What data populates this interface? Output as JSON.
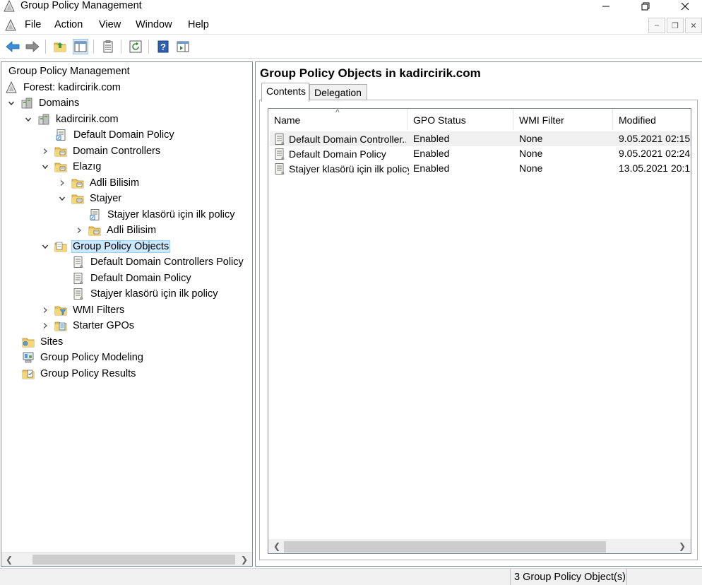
{
  "window": {
    "title": "Group Policy Management"
  },
  "menu": {
    "items": [
      "File",
      "Action",
      "View",
      "Window",
      "Help"
    ]
  },
  "tree": {
    "root": "Group Policy Management",
    "forest": "Forest: kadircirik.com",
    "domains": "Domains",
    "domain": "kadircirik.com",
    "default_domain_policy": "Default Domain Policy",
    "domain_controllers": "Domain Controllers",
    "elazig": "Elazıg",
    "adli_bilisim_1": "Adli Bilisim",
    "stajyer": "Stajyer",
    "stajyer_policy": "Stajyer klasörü için ilk policy",
    "adli_bilisim_2": "Adli Bilisim",
    "gpo": "Group Policy Objects",
    "gpo_ddcp": "Default Domain Controllers Policy",
    "gpo_ddp": "Default Domain Policy",
    "gpo_stajyer": "Stajyer klasörü için ilk policy",
    "wmi_filters": "WMI Filters",
    "starter_gpos": "Starter GPOs",
    "sites": "Sites",
    "modeling": "Group Policy Modeling",
    "results": "Group Policy Results"
  },
  "content": {
    "title": "Group Policy Objects in kadircirik.com",
    "tabs": [
      "Contents",
      "Delegation"
    ],
    "columns": [
      "Name",
      "GPO Status",
      "WMI Filter",
      "Modified"
    ],
    "rows": [
      {
        "name": "Default Domain Controller...",
        "status": "Enabled",
        "wmi": "None",
        "modified": "9.05.2021 02:15:"
      },
      {
        "name": "Default Domain Policy",
        "status": "Enabled",
        "wmi": "None",
        "modified": "9.05.2021 02:24:"
      },
      {
        "name": "Stajyer klasörü için ilk policy",
        "status": "Enabled",
        "wmi": "None",
        "modified": "13.05.2021 20:1"
      }
    ]
  },
  "status": {
    "text": "3 Group Policy Object(s)"
  },
  "icons": {
    "policy": "gpo-scroll-icon",
    "folder": "folder-icon",
    "ou": "ou-folder-icon"
  },
  "colors": {
    "selection": "#cce8ff",
    "selection_border": "#99d1ff",
    "link_blue": "#1e6fc4"
  }
}
